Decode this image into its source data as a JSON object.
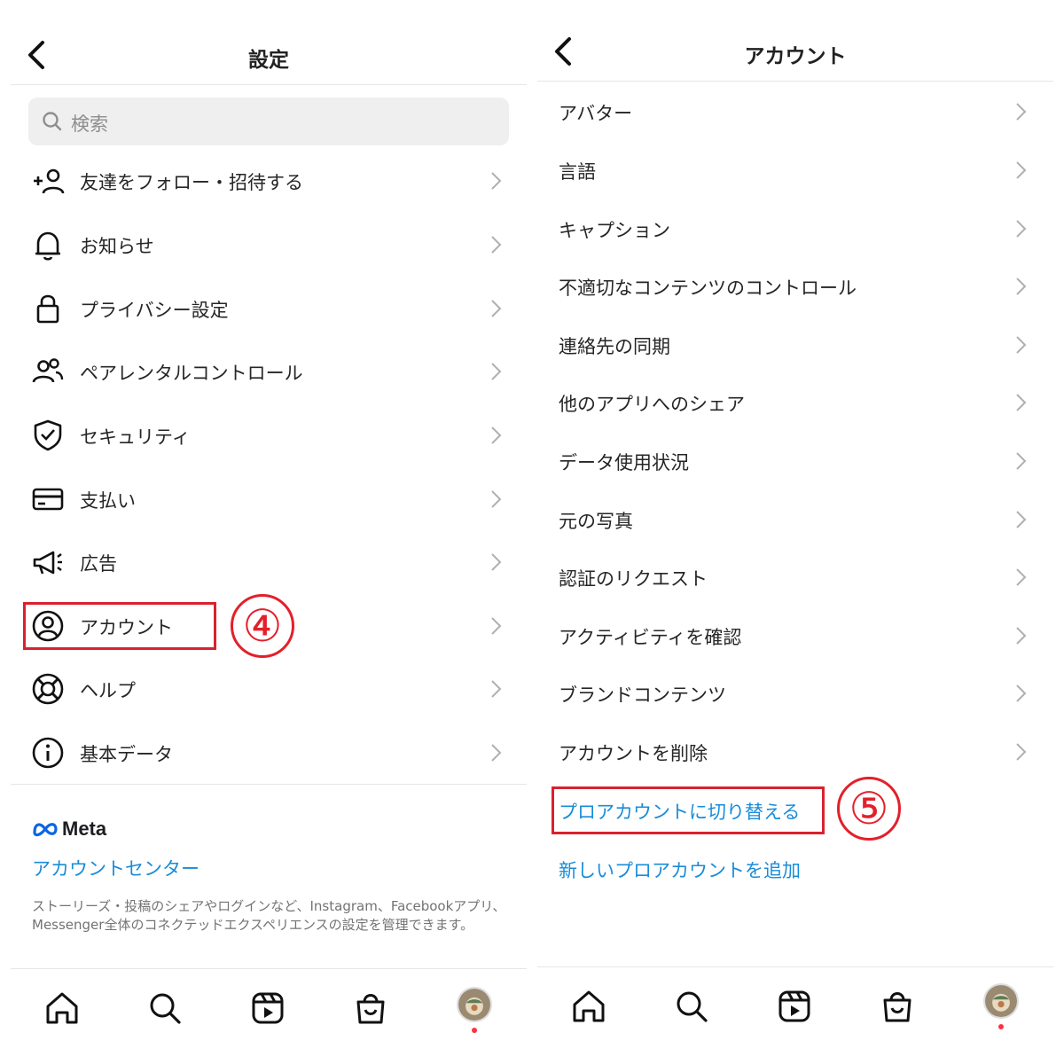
{
  "left": {
    "title": "設定",
    "search": {
      "placeholder": "検索"
    },
    "items": [
      {
        "label": "友達をフォロー・招待する",
        "icon": "add-person-icon"
      },
      {
        "label": "お知らせ",
        "icon": "bell-icon"
      },
      {
        "label": "プライバシー設定",
        "icon": "lock-icon"
      },
      {
        "label": "ペアレンタルコントロール",
        "icon": "people-icon"
      },
      {
        "label": "セキュリティ",
        "icon": "shield-icon"
      },
      {
        "label": "支払い",
        "icon": "card-icon"
      },
      {
        "label": "広告",
        "icon": "megaphone-icon"
      },
      {
        "label": "アカウント",
        "icon": "account-circle-icon"
      },
      {
        "label": "ヘルプ",
        "icon": "lifebuoy-icon"
      },
      {
        "label": "基本データ",
        "icon": "info-icon"
      }
    ],
    "meta": {
      "word": "Meta",
      "account_center": "アカウントセンター",
      "description": "ストーリーズ・投稿のシェアやログインなど、Instagram、Facebookアプリ、Messenger全体のコネクテッドエクスペリエンスの設定を管理できます。"
    },
    "annotation": "④"
  },
  "right": {
    "title": "アカウント",
    "items": [
      {
        "label": "アバター"
      },
      {
        "label": "言語"
      },
      {
        "label": "キャプション"
      },
      {
        "label": "不適切なコンテンツのコントロール"
      },
      {
        "label": "連絡先の同期"
      },
      {
        "label": "他のアプリへのシェア"
      },
      {
        "label": "データ使用状況"
      },
      {
        "label": "元の写真"
      },
      {
        "label": "認証のリクエスト"
      },
      {
        "label": "アクティビティを確認"
      },
      {
        "label": "ブランドコンテンツ"
      },
      {
        "label": "アカウントを削除"
      }
    ],
    "links": {
      "switch_pro": "プロアカウントに切り替える",
      "add_pro": "新しいプロアカウントを追加"
    },
    "annotation": "⑤"
  },
  "tabbar": {
    "tabs": [
      "home-icon",
      "search-icon",
      "reels-icon",
      "shop-icon",
      "profile-avatar"
    ]
  },
  "colors": {
    "link": "#1a8cd8",
    "highlight": "#d9222e",
    "notification_dot": "#ff3040"
  }
}
